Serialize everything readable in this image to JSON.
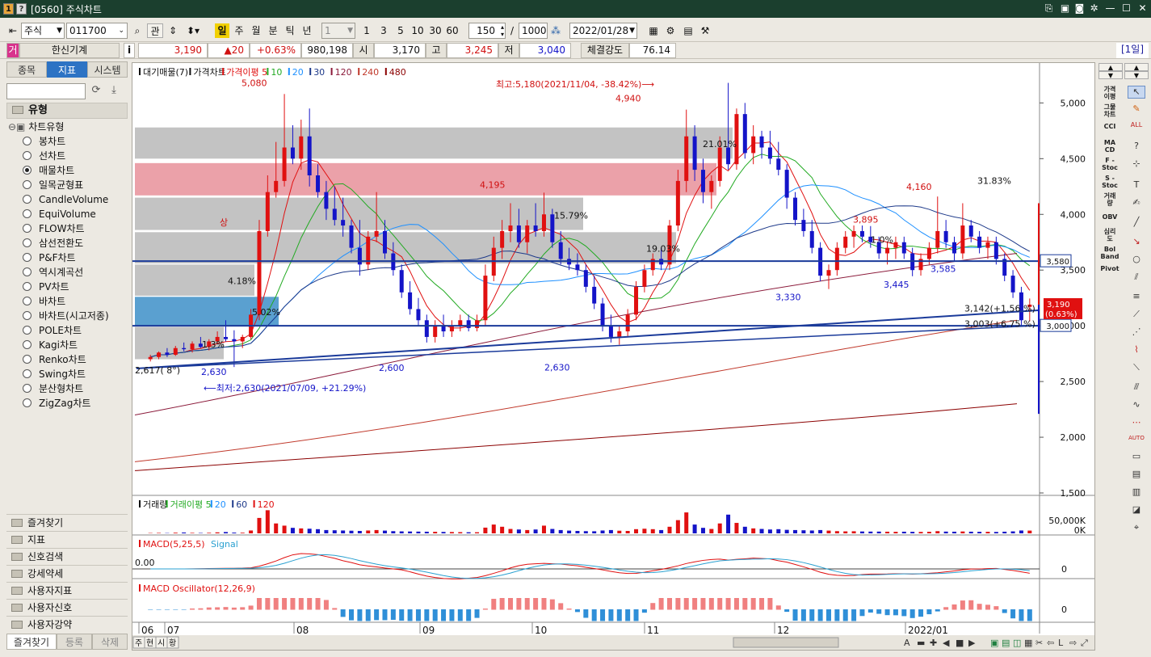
{
  "window": {
    "title": "[0560] 주식차트"
  },
  "toolbar": {
    "market": "주식",
    "code": "011700",
    "btn_gwan": "관",
    "periods": [
      "일",
      "주",
      "월",
      "분",
      "틱",
      "년"
    ],
    "count_select": "1",
    "quick_counts": [
      "1",
      "3",
      "5",
      "10",
      "30",
      "60"
    ],
    "display_count": "150",
    "slash": "/",
    "max_count": "1000",
    "date": "2022/01/28"
  },
  "quote": {
    "name_tag": "거",
    "name": "한신기계",
    "info": "i",
    "price": "3,190",
    "change": "▲20",
    "change_pct": "+0.63%",
    "volume": "980,198",
    "open_label": "시",
    "open": "3,170",
    "high_label": "고",
    "high": "3,245",
    "low_label": "저",
    "low": "3,040",
    "strength_label": "체결강도",
    "strength": "76.14",
    "period_badge": "[1일]"
  },
  "left_panel": {
    "tabs": [
      "종목",
      "지표",
      "시스템"
    ],
    "section": "유형",
    "tree_root": "차트유형",
    "chart_types": [
      "봉차트",
      "선차트",
      "매물차트",
      "일목균형표",
      "CandleVolume",
      "EquiVolume",
      "FLOW차트",
      "삼선전환도",
      "P&F차트",
      "역시계곡선",
      "PV차트",
      "바차트",
      "바차트(시고저종)",
      "POLE차트",
      "Kagi차트",
      "Renko차트",
      "Swing차트",
      "분산형차트",
      "ZigZag차트"
    ],
    "selected": "매물차트",
    "folders": [
      "즐겨찾기",
      "지표",
      "신호검색",
      "강세약세",
      "사용자지표",
      "사용자신호",
      "사용자강약"
    ],
    "bottom_tabs": [
      "즐겨찾기",
      "등록",
      "삭제"
    ]
  },
  "right_labels": [
    "가격\n이평",
    "그물\n차트",
    "CCI",
    "MA\nCD",
    "F -\nStoc",
    "S -\nStoc",
    "거래\n량",
    "OBV",
    "심리\n도",
    "Bol\nBand",
    "Pivot"
  ],
  "colors": {
    "up": "#e01010",
    "down": "#1414c8",
    "ma5": "#e01010",
    "ma10": "#22aa22",
    "ma20": "#1e90ff",
    "ma30": "#1e3a8a",
    "ma120": "#8b1a3a",
    "ma240": "#c0392b",
    "ma480": "#8b0000",
    "profile": "#b8b8b8",
    "profile_hi": "#e8909a",
    "profile_low": "#3d8fc8"
  },
  "chart_data": [
    {
      "type": "candlestick",
      "title": "대기매물(7) 가격차트",
      "legend": [
        "대기매물(7)",
        "가격차트",
        "가격이평 5",
        "10",
        "20",
        "30",
        "120",
        "240",
        "480"
      ],
      "y_ticks": [
        "5,000",
        "4,500",
        "4,000",
        "3,500",
        "3,000",
        "2,500",
        "2,000",
        "1,500"
      ],
      "ylim": [
        1500,
        5300
      ],
      "x_ticks": [
        "06",
        "07",
        "08",
        "09",
        "10",
        "11",
        "12",
        "2022/01"
      ],
      "ohlc": [
        [
          2700,
          2740,
          2680,
          2720
        ],
        [
          2720,
          2770,
          2700,
          2760
        ],
        [
          2760,
          2800,
          2720,
          2740
        ],
        [
          2740,
          2820,
          2730,
          2800
        ],
        [
          2800,
          2850,
          2770,
          2790
        ],
        [
          2790,
          2860,
          2760,
          2840
        ],
        [
          2840,
          2900,
          2800,
          2810
        ],
        [
          2810,
          2880,
          2780,
          2860
        ],
        [
          2860,
          2950,
          2840,
          2900
        ],
        [
          2900,
          3050,
          2860,
          2880
        ],
        [
          2880,
          2960,
          2630,
          2860
        ],
        [
          2860,
          2920,
          2800,
          2900
        ],
        [
          2900,
          3150,
          2880,
          3100
        ],
        [
          3100,
          3950,
          3050,
          3850
        ],
        [
          3850,
          4350,
          3800,
          4200
        ],
        [
          4200,
          4650,
          4150,
          4300
        ],
        [
          4300,
          5080,
          4250,
          4600
        ],
        [
          4600,
          4800,
          4450,
          4500
        ],
        [
          4500,
          4850,
          4400,
          4700
        ],
        [
          4700,
          4950,
          4250,
          4350
        ],
        [
          4350,
          4450,
          4150,
          4200
        ],
        [
          4200,
          4300,
          3950,
          4050
        ],
        [
          4050,
          4250,
          3900,
          3950
        ],
        [
          3950,
          4150,
          3800,
          3900
        ],
        [
          3900,
          3950,
          3650,
          3700
        ],
        [
          3700,
          3950,
          3450,
          3550
        ],
        [
          3550,
          3850,
          3500,
          3800
        ],
        [
          3800,
          4200,
          3750,
          3850
        ],
        [
          3850,
          3950,
          3600,
          3650
        ],
        [
          3650,
          3750,
          3450,
          3500
        ],
        [
          3500,
          3550,
          3250,
          3300
        ],
        [
          3300,
          3400,
          3100,
          3150
        ],
        [
          3150,
          3250,
          3000,
          3050
        ],
        [
          3050,
          3100,
          2850,
          2900
        ],
        [
          2900,
          3050,
          2850,
          3000
        ],
        [
          3000,
          3100,
          2900,
          2950
        ],
        [
          2950,
          3050,
          2900,
          3000
        ],
        [
          3000,
          3100,
          2950,
          3050
        ],
        [
          3050,
          3100,
          2950,
          2980
        ],
        [
          2980,
          3100,
          2950,
          3050
        ],
        [
          3050,
          3550,
          3000,
          3450
        ],
        [
          3450,
          3800,
          3400,
          3700
        ],
        [
          3700,
          3950,
          3600,
          3850
        ],
        [
          3850,
          4100,
          3750,
          3900
        ],
        [
          3900,
          4050,
          3700,
          3750
        ],
        [
          3750,
          3950,
          3650,
          3900
        ],
        [
          3900,
          4100,
          3800,
          3850
        ],
        [
          3850,
          4195,
          3800,
          4000
        ],
        [
          4000,
          4050,
          3700,
          3750
        ],
        [
          3750,
          3850,
          3550,
          3600
        ],
        [
          3600,
          3700,
          3500,
          3550
        ],
        [
          3550,
          3650,
          3450,
          3500
        ],
        [
          3500,
          3550,
          3300,
          3350
        ],
        [
          3350,
          3450,
          3150,
          3200
        ],
        [
          3200,
          3250,
          2950,
          3000
        ],
        [
          3000,
          3100,
          2850,
          2900
        ],
        [
          2900,
          3000,
          2830,
          2950
        ],
        [
          2950,
          3150,
          2900,
          3100
        ],
        [
          3100,
          3400,
          3050,
          3350
        ],
        [
          3350,
          3550,
          3300,
          3500
        ],
        [
          3500,
          3650,
          3450,
          3600
        ],
        [
          3600,
          3700,
          3500,
          3550
        ],
        [
          3550,
          3950,
          3500,
          3900
        ],
        [
          3900,
          4400,
          3850,
          4300
        ],
        [
          4300,
          4940,
          4200,
          4700
        ],
        [
          4700,
          4800,
          4300,
          4400
        ],
        [
          4400,
          4500,
          4100,
          4200
        ],
        [
          4200,
          4350,
          4050,
          4300
        ],
        [
          4300,
          4700,
          4250,
          4600
        ],
        [
          4600,
          5180,
          4400,
          4450
        ],
        [
          4450,
          4950,
          4400,
          4900
        ],
        [
          4900,
          5000,
          4500,
          4550
        ],
        [
          4550,
          4800,
          4450,
          4700
        ],
        [
          4700,
          4750,
          4500,
          4600
        ],
        [
          4600,
          4750,
          4450,
          4500
        ],
        [
          4500,
          4650,
          4350,
          4400
        ],
        [
          4400,
          4450,
          4050,
          4150
        ],
        [
          4150,
          4200,
          3900,
          3950
        ],
        [
          3950,
          4050,
          3800,
          3850
        ],
        [
          3850,
          3950,
          3650,
          3700
        ],
        [
          3700,
          3750,
          3400,
          3450
        ],
        [
          3450,
          3550,
          3330,
          3500
        ],
        [
          3500,
          3750,
          3450,
          3700
        ],
        [
          3700,
          3850,
          3650,
          3800
        ],
        [
          3800,
          3900,
          3700,
          3850
        ],
        [
          3850,
          3900,
          3750,
          3800
        ],
        [
          3800,
          3895,
          3700,
          3750
        ],
        [
          3750,
          3800,
          3600,
          3650
        ],
        [
          3650,
          3750,
          3550,
          3700
        ],
        [
          3700,
          3800,
          3600,
          3750
        ],
        [
          3750,
          3800,
          3600,
          3650
        ],
        [
          3650,
          3700,
          3445,
          3500
        ],
        [
          3500,
          3650,
          3450,
          3600
        ],
        [
          3600,
          3750,
          3550,
          3700
        ],
        [
          3700,
          4160,
          3650,
          3850
        ],
        [
          3850,
          3950,
          3700,
          3750
        ],
        [
          3750,
          3800,
          3585,
          3650
        ],
        [
          3650,
          4100,
          3600,
          3900
        ],
        [
          3900,
          3950,
          3750,
          3800
        ],
        [
          3800,
          3850,
          3650,
          3700
        ],
        [
          3700,
          3800,
          3600,
          3750
        ],
        [
          3750,
          3800,
          3550,
          3600
        ],
        [
          3600,
          3650,
          3400,
          3450
        ],
        [
          3450,
          3500,
          3250,
          3300
        ],
        [
          3300,
          3350,
          3000,
          3050
        ],
        [
          3170,
          3245,
          3040,
          3190
        ]
      ],
      "volume": [
        30,
        40,
        25,
        60,
        80,
        45,
        35,
        50,
        90,
        120,
        70,
        60,
        260,
        1400,
        2100,
        900,
        700,
        500,
        450,
        420,
        380,
        300,
        280,
        260,
        240,
        220,
        260,
        300,
        250,
        200,
        180,
        170,
        160,
        150,
        140,
        130,
        120,
        110,
        100,
        100,
        520,
        800,
        600,
        400,
        350,
        300,
        350,
        700,
        400,
        300,
        250,
        220,
        200,
        190,
        260,
        300,
        240,
        220,
        380,
        420,
        380,
        300,
        600,
        1200,
        1900,
        800,
        500,
        400,
        900,
        1700,
        950,
        600,
        450,
        400,
        350,
        380,
        320,
        300,
        280,
        260,
        300,
        250,
        200,
        180,
        190,
        170,
        160,
        160,
        150,
        140,
        150,
        140,
        130,
        140,
        200,
        160,
        150,
        170,
        150,
        140,
        140,
        130,
        150,
        180,
        260,
        250
      ],
      "annotations": {
        "max_label": "5,080",
        "peak_label": "4,940",
        "mid_label": "4,195",
        "low_label": "2,630",
        "low2_label": "2,600",
        "low3_label": "2,630",
        "right_peak": "4,160",
        "r_3895": "3,895",
        "r_3330": "3,330",
        "r_3445": "3,445",
        "r_3585": "3,585",
        "line_3142": "3,142(+1.56 %)",
        "line_3003": "3,003(+6.75 %)",
        "start_label": "2,617( 8°)",
        "high_note": "최고:5,180(2021/11/04, -38.42%)⟶",
        "low_note": "⟵최저:2,630(2021/07/09, +21.29%)",
        "pct_1": "31.83%",
        "pct_2": "21.01%",
        "pct_3": "15.79%",
        "pct_4": "19.03%",
        "pct_5": "4.18%",
        "pct_6": "5.02%",
        "pct_7": "1.0%",
        "pct_8": "1.3%",
        "marker_up": "상",
        "price_tag": "3,190",
        "price_tag_pct": "(0.63%)",
        "hline_1": "3,580",
        "hline_2": "3,000"
      },
      "volume_profile": [
        {
          "price_from": 4500,
          "price_to": 4780,
          "pct": "21.01%"
        },
        {
          "price_from": 4170,
          "price_to": 4460,
          "pct": "31.83%"
        },
        {
          "price_from": 3860,
          "price_to": 4150,
          "pct": "15.79%"
        },
        {
          "price_from": 3560,
          "price_to": 3840,
          "pct": "19.03%"
        },
        {
          "price_from": 3270,
          "price_to": 3550,
          "pct": "4.18%"
        },
        {
          "price_from": 3000,
          "price_to": 3260,
          "pct": "5.02%"
        },
        {
          "price_from": 2700,
          "price_to": 2990,
          "pct": "1.3%"
        }
      ]
    },
    {
      "type": "bar",
      "title": "거래량",
      "legend": [
        "거래량",
        "거래이평 5",
        "20",
        "60",
        "120"
      ],
      "y_ticks": [
        "50,000K",
        "0K"
      ]
    },
    {
      "type": "line",
      "title": "MACD(5,25,5)",
      "legend": [
        "MACD(5,25,5)",
        "Signal"
      ],
      "y_ticks": [
        "0"
      ],
      "left_value": "0.00"
    },
    {
      "type": "bar",
      "title": "MACD Oscillator(12,26,9)",
      "y_ticks": [
        "0"
      ]
    }
  ],
  "chart_bottom": {
    "tabs": [
      "주",
      "현",
      "시",
      "황"
    ]
  }
}
